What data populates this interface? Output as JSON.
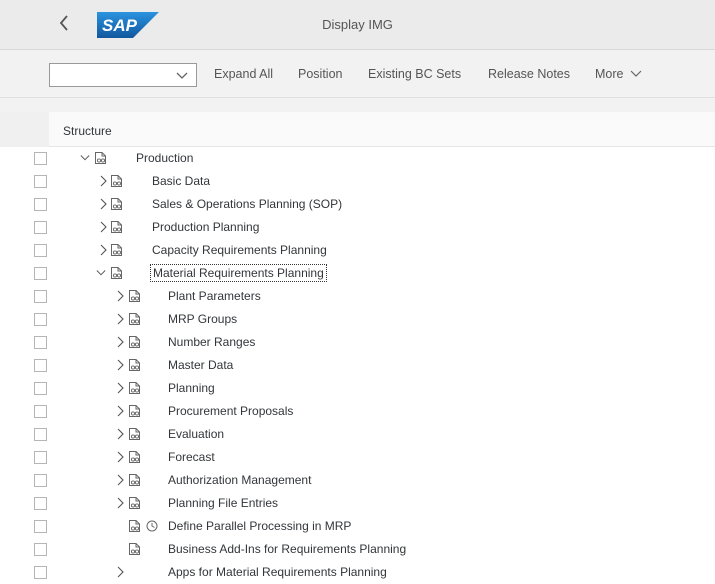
{
  "shell": {
    "back_glyph": "<",
    "logo_text": "SAP",
    "title": "Display IMG"
  },
  "toolbar": {
    "combo_value": "",
    "buttons": [
      "Expand All",
      "Position",
      "Existing BC Sets",
      "Release Notes",
      "More"
    ]
  },
  "tree": {
    "header": "Structure",
    "rows": [
      {
        "label": "Production",
        "level": 0,
        "expander": "expanded",
        "doc": true,
        "clock": false
      },
      {
        "label": "Basic Data",
        "level": 1,
        "expander": "collapsed",
        "doc": true,
        "clock": false
      },
      {
        "label": "Sales & Operations Planning (SOP)",
        "level": 1,
        "expander": "collapsed",
        "doc": true,
        "clock": false
      },
      {
        "label": "Production Planning",
        "level": 1,
        "expander": "collapsed",
        "doc": true,
        "clock": false
      },
      {
        "label": "Capacity Requirements Planning",
        "level": 1,
        "expander": "collapsed",
        "doc": true,
        "clock": false
      },
      {
        "label": "Material Requirements Planning",
        "level": 1,
        "expander": "expanded",
        "doc": true,
        "clock": false,
        "focused": true
      },
      {
        "label": "Plant Parameters",
        "level": 2,
        "expander": "collapsed",
        "doc": true,
        "clock": false
      },
      {
        "label": "MRP Groups",
        "level": 2,
        "expander": "collapsed",
        "doc": true,
        "clock": false
      },
      {
        "label": "Number Ranges",
        "level": 2,
        "expander": "collapsed",
        "doc": true,
        "clock": false
      },
      {
        "label": "Master Data",
        "level": 2,
        "expander": "collapsed",
        "doc": true,
        "clock": false
      },
      {
        "label": "Planning",
        "level": 2,
        "expander": "collapsed",
        "doc": true,
        "clock": false
      },
      {
        "label": "Procurement Proposals",
        "level": 2,
        "expander": "collapsed",
        "doc": true,
        "clock": false
      },
      {
        "label": "Evaluation",
        "level": 2,
        "expander": "collapsed",
        "doc": true,
        "clock": false
      },
      {
        "label": "Forecast",
        "level": 2,
        "expander": "collapsed",
        "doc": true,
        "clock": false
      },
      {
        "label": "Authorization Management",
        "level": 2,
        "expander": "collapsed",
        "doc": true,
        "clock": false
      },
      {
        "label": "Planning File Entries",
        "level": 2,
        "expander": "collapsed",
        "doc": true,
        "clock": false
      },
      {
        "label": "Define Parallel Processing in MRP",
        "level": 2,
        "expander": "none",
        "doc": true,
        "clock": true
      },
      {
        "label": "Business Add-Ins for Requirements Planning",
        "level": 2,
        "expander": "none",
        "doc": true,
        "clock": false
      },
      {
        "label": "Apps for Material Requirements Planning",
        "level": 2,
        "expander": "collapsed",
        "doc": false,
        "clock": false
      }
    ]
  },
  "icons": {
    "expanded": "chevron-down-icon",
    "collapsed": "chevron-right-icon",
    "doc": "document-glasses-icon",
    "clock": "clock-icon"
  },
  "colors": {
    "shell_bg": "#ebebeb",
    "toolbar_bg": "#f2f2f2",
    "logo_blue": "#1d7fcd",
    "text": "#32363a"
  }
}
